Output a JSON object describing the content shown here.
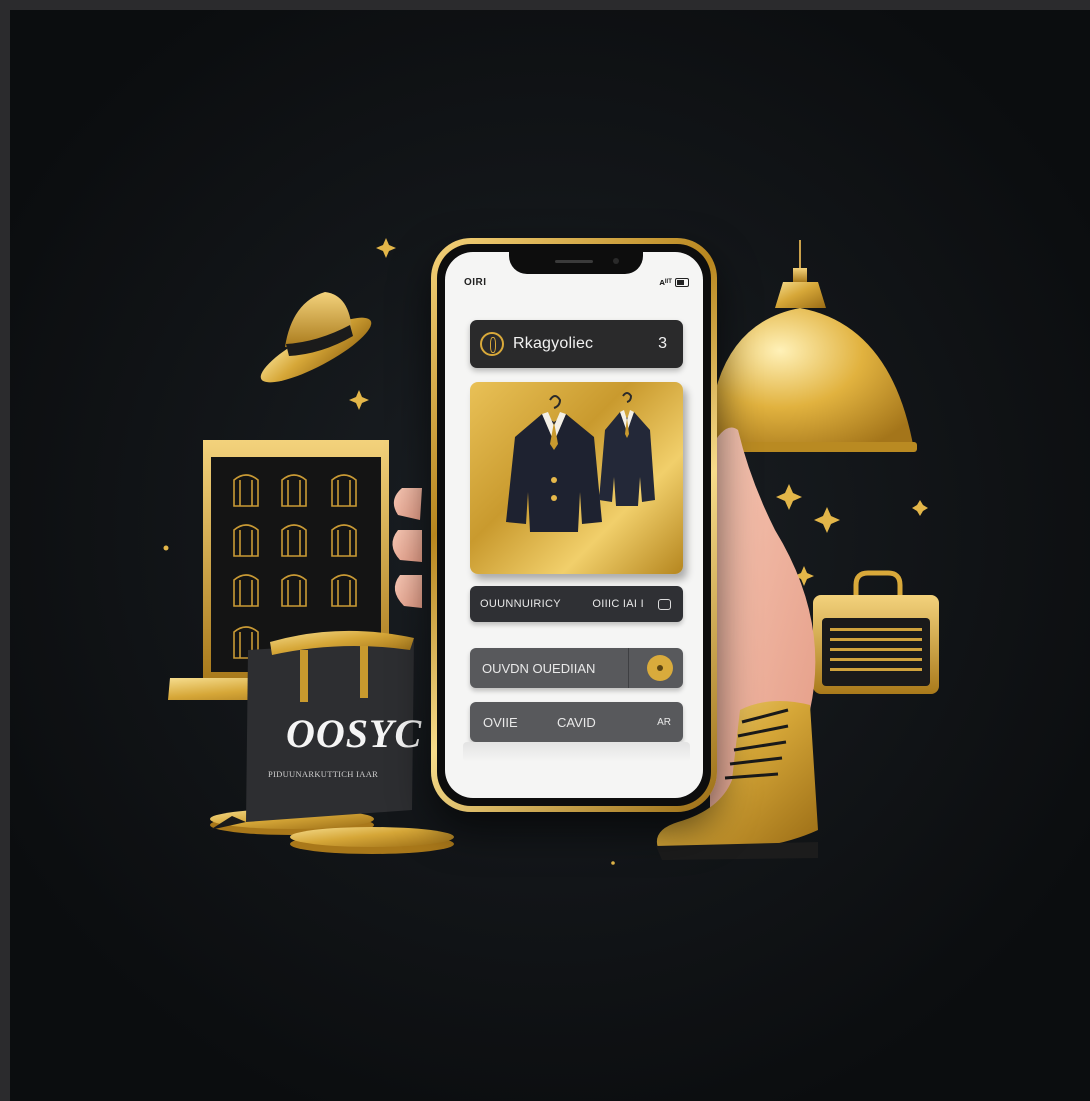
{
  "colors": {
    "accent_gold": "#d9a93a",
    "background": "#0e1114",
    "screen": "#f5f5f4",
    "panel_dark": "#2a2a2b",
    "panel_gray": "#58595c"
  },
  "status_bar": {
    "time": "OIRI",
    "right": "ᴀᴵᴵᵀ"
  },
  "app_header": {
    "icon": "hanger-logo-icon",
    "title": "Rkagyoliec",
    "count": "3"
  },
  "product": {
    "image": "suit-jackets-on-hangers",
    "item_count": 2
  },
  "rows": [
    {
      "left": "OUUNNUIRICY",
      "middle": "OIIIC IAI I",
      "icon": "card-icon"
    },
    {
      "left": "OUVDN  OUEDIIAN",
      "icon": "toggle-icon"
    },
    {
      "left": "OVIIE",
      "center": "CAVID",
      "right": "AR"
    }
  ],
  "shopping_bag": {
    "headline": "OOSYC",
    "subline": "PIDUUNARKUTTICH IAAR"
  },
  "decor": [
    "fedora-hat-icon",
    "display-shelf-icon",
    "gold-coins-icon",
    "pendant-lamp-icon",
    "sparkle-icon",
    "briefcase-icon",
    "gold-boot-icon",
    "hand-icon"
  ]
}
